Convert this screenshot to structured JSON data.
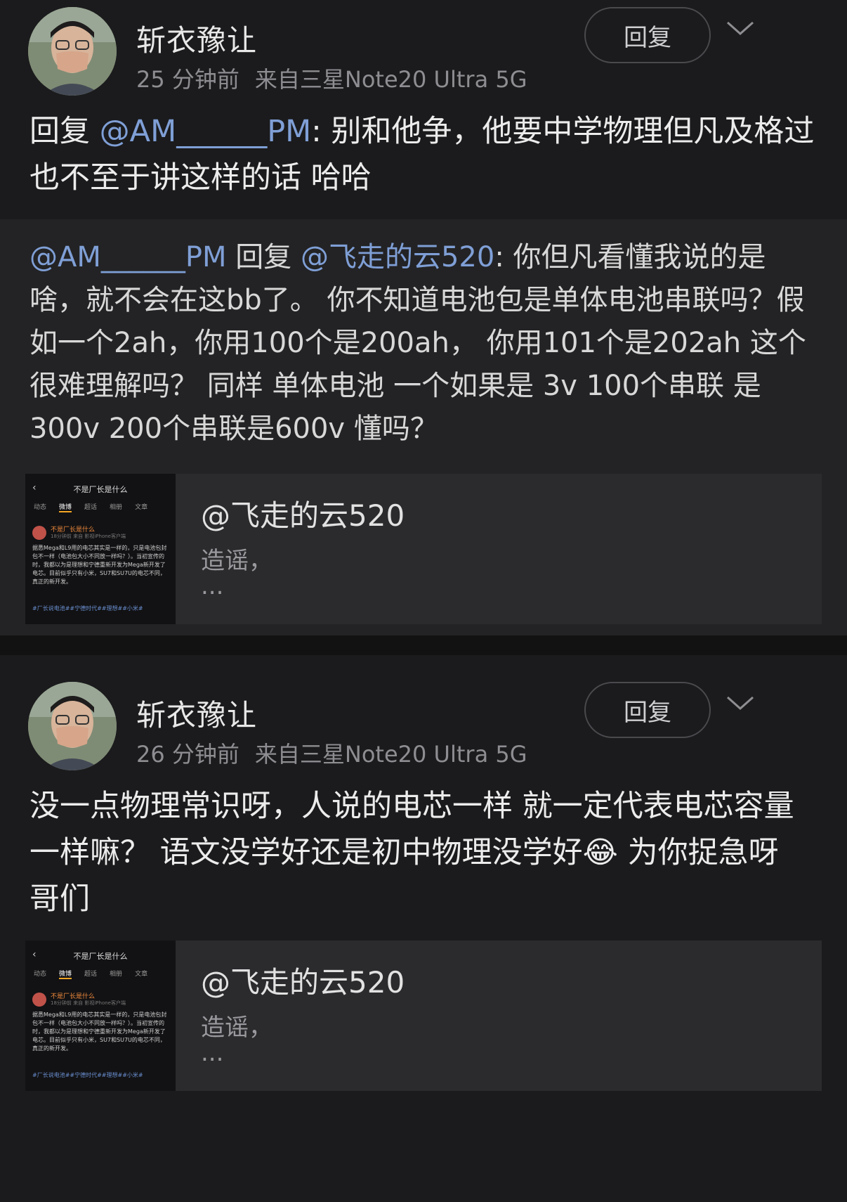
{
  "comments": [
    {
      "username": "斩衣豫让",
      "time": "25 分钟前",
      "source": "来自三星Note20 Ultra 5G",
      "reply_label": "回复",
      "body_prefix": "回复 ",
      "body_mention": "@AM______PM",
      "body_text": ": 别和他争，他要中学物理但凡及格过也不至于讲这样的话  哈哈",
      "quote_mention": "@AM______PM",
      "quote_reply_word": " 回复 ",
      "quote_mention2": "@飞走的云520",
      "quote_text": ": 你但凡看懂我说的是啥，就不会在这bb了。 你不知道电池包是单体电池串联吗？假如一个2ah，你用100个是200ah， 你用101个是202ah 这个很难理解吗？ 同样 单体电池 一个如果是 3v 100个串联 是300v  200个串联是600v 懂吗？",
      "embed": {
        "title": "@飞走的云520",
        "desc": "造谣，",
        "dots": "..."
      }
    },
    {
      "username": "斩衣豫让",
      "time": "26 分钟前",
      "source": "来自三星Note20 Ultra 5G",
      "reply_label": "回复",
      "body_text": "没一点物理常识呀，人说的电芯一样  就一定代表电芯容量一样嘛？  语文没学好还是初中物理没学好",
      "body_emoji": "😂",
      "body_text2": "   为你捉急呀 哥们",
      "embed": {
        "title": "@飞走的云520",
        "desc": "造谣，",
        "dots": "..."
      }
    }
  ],
  "thumbnail": {
    "back": "‹",
    "title": "不是厂长是什么",
    "tabs": [
      "动态",
      "微博",
      "超话",
      "相册",
      "文章"
    ],
    "name": "不是厂长是什么",
    "sub": "18分钟前 来自 影视iPhone客户端",
    "body": "据悉Mega和L9用的电芯其实是一样的，只是电池包封包不一样（电池包大小不同放一样吗？）。当初宣传的时，我都以为是理想和宁德重新开发为Mega新开发了电芯。目前似乎只有小米，SU7和SU7U的电芯不同，真正的新开发。",
    "tag": "#厂长说电池##宁德时代##理想##小米#"
  }
}
